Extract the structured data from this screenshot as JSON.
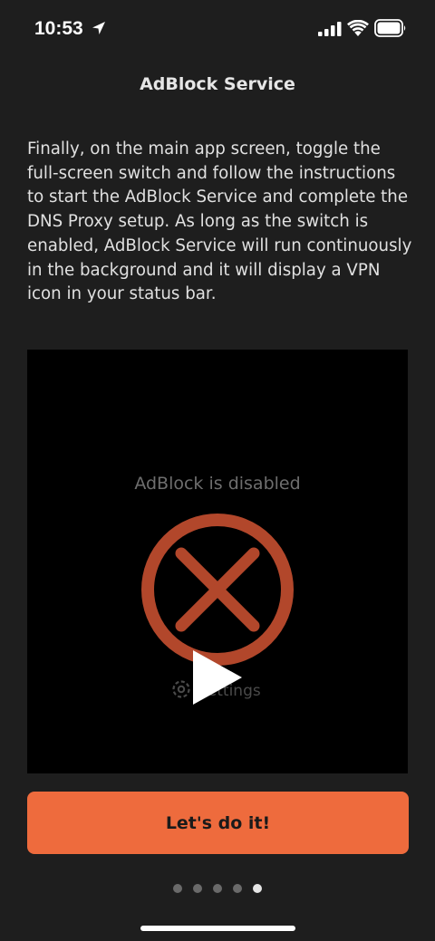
{
  "status_bar": {
    "time": "10:53",
    "icons": [
      "location-arrow-icon",
      "cellular-signal-icon",
      "wifi-icon",
      "battery-icon"
    ]
  },
  "header": {
    "title": "AdBlock Service"
  },
  "main": {
    "description": "Finally, on the main app screen, toggle the full-screen switch and follow the instructions to start the AdBlock Service and complete the DNS Proxy setup. As long as the switch is enabled, AdBlock Service will run continuously in the background and it will display a VPN icon in your status bar.",
    "video": {
      "status_text": "AdBlock is disabled",
      "settings_label": "Settings",
      "icons": [
        "disabled-x-icon",
        "gear-icon",
        "play-icon"
      ]
    }
  },
  "footer": {
    "cta_label": "Let's do it!",
    "page_count": 5,
    "active_page": 5
  },
  "colors": {
    "background": "#1e1e1e",
    "video_background": "#000000",
    "accent": "#ee6b3d",
    "disabled_red": "#b2472b"
  }
}
